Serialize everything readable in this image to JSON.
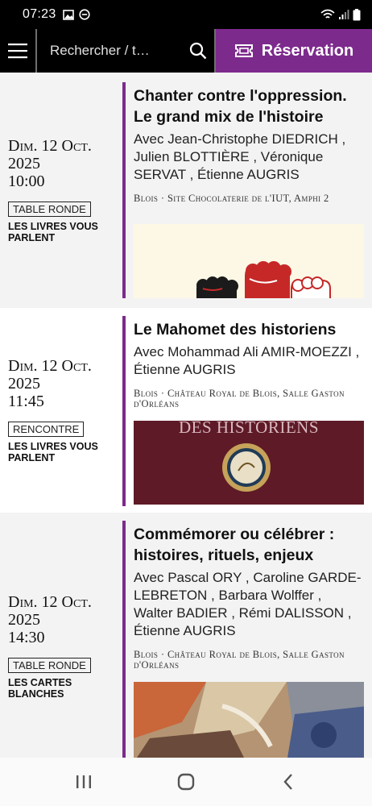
{
  "status_bar": {
    "time": "07:23",
    "left_icons": [
      "image-icon",
      "dnd-icon"
    ],
    "right_icons": [
      "wifi-icon",
      "signal-icon",
      "battery-icon"
    ]
  },
  "top_bar": {
    "search_placeholder": "Rechercher / t…",
    "reservation_label": "Réservation",
    "accent_color": "#7d2a8d"
  },
  "events": [
    {
      "date_day": "Dim. 12 Oct.",
      "date_year": "2025",
      "date_time": "10:00",
      "tag": "TABLE RONDE",
      "cycle": "LES LIVRES VOUS PARLENT",
      "title": "Chanter contre l'oppression. Le grand mix de l'histoire",
      "speakers": "Avec Jean-Christophe DIEDRICH , Julien BLOTTIÈRE , Véronique SERVAT , Étienne AUGRIS",
      "place": "Blois · Site Chocolaterie de l'IUT, Amphi 2"
    },
    {
      "date_day": "Dim. 12 Oct.",
      "date_year": "2025",
      "date_time": "11:45",
      "tag": "RENCONTRE",
      "cycle": "LES LIVRES VOUS PARLENT",
      "title": "Le Mahomet des historiens",
      "speakers": "Avec Mohammad Ali AMIR-MOEZZI , Étienne AUGRIS",
      "place": "Blois · Château Royal de Blois, Salle Gaston d'Orléans",
      "image_text": "DES HISTORIENS"
    },
    {
      "date_day": "Dim. 12 Oct.",
      "date_year": "2025",
      "date_time": "14:30",
      "tag": "TABLE RONDE",
      "cycle": "LES CARTES BLANCHES",
      "title": "Commémorer ou célébrer : histoires, rituels, enjeux",
      "speakers": "Avec Pascal ORY , Caroline GARDE-LEBRETON , Barbara Wolffer , Walter BADIER , Rémi DALISSON , Étienne AUGRIS",
      "place": "Blois · Château Royal de Blois, Salle Gaston d'Orléans"
    }
  ],
  "nav_bar": {
    "buttons": [
      "recent-apps-icon",
      "home-icon",
      "back-icon"
    ]
  }
}
